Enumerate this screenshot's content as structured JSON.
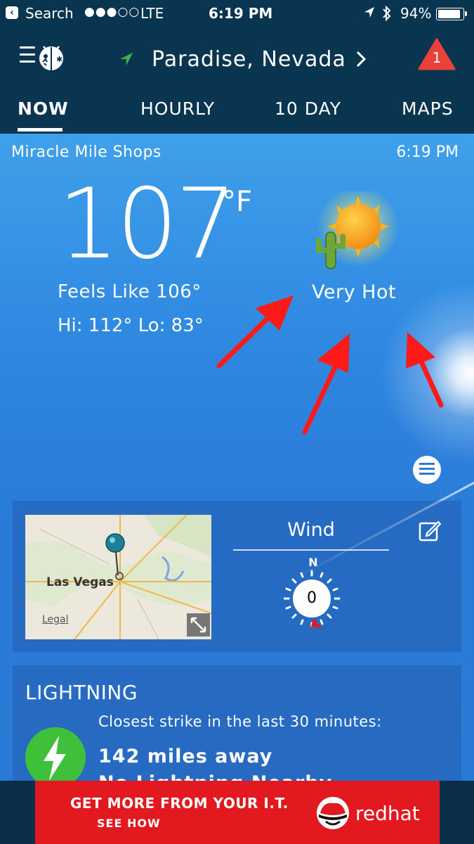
{
  "status_bar": {
    "back_label": "Search",
    "signal": "●●●○○",
    "carrier": "LTE",
    "time": "6:19 PM",
    "battery_percent": "94%",
    "battery_level": 0.94
  },
  "header": {
    "location": "Paradise, Nevada",
    "alert_count": "1"
  },
  "tabs": [
    "NOW",
    "HOURLY",
    "10 DAY",
    "MAPS"
  ],
  "current": {
    "station": "Miracle Mile Shops",
    "time": "6:19 PM",
    "temperature": "107",
    "unit": "°F",
    "feels_like": "Feels Like 106°",
    "hi_lo": "Hi: 112°  Lo: 83°",
    "condition": "Very Hot",
    "condition_icon": "sun-cactus-icon"
  },
  "map_card": {
    "city_label": "Las Vegas",
    "legal": "Legal"
  },
  "wind": {
    "title": "Wind",
    "direction": "N",
    "speed": "0"
  },
  "lightning": {
    "title": "LIGHTNING",
    "subtitle": "Closest strike in the last 30 minutes:",
    "distance": "142 miles away",
    "extra": "No Lightning Nearby"
  },
  "ad": {
    "headline": "GET MORE FROM YOUR I.T.",
    "cta": "SEE HOW",
    "brand": "redhat"
  },
  "colors": {
    "header_bg": "#0a3550",
    "alert_red": "#e8423b",
    "lightning_green": "#3ec03a",
    "ad_red": "#e21a1f",
    "annotation_arrow": "#ff1a1a"
  }
}
